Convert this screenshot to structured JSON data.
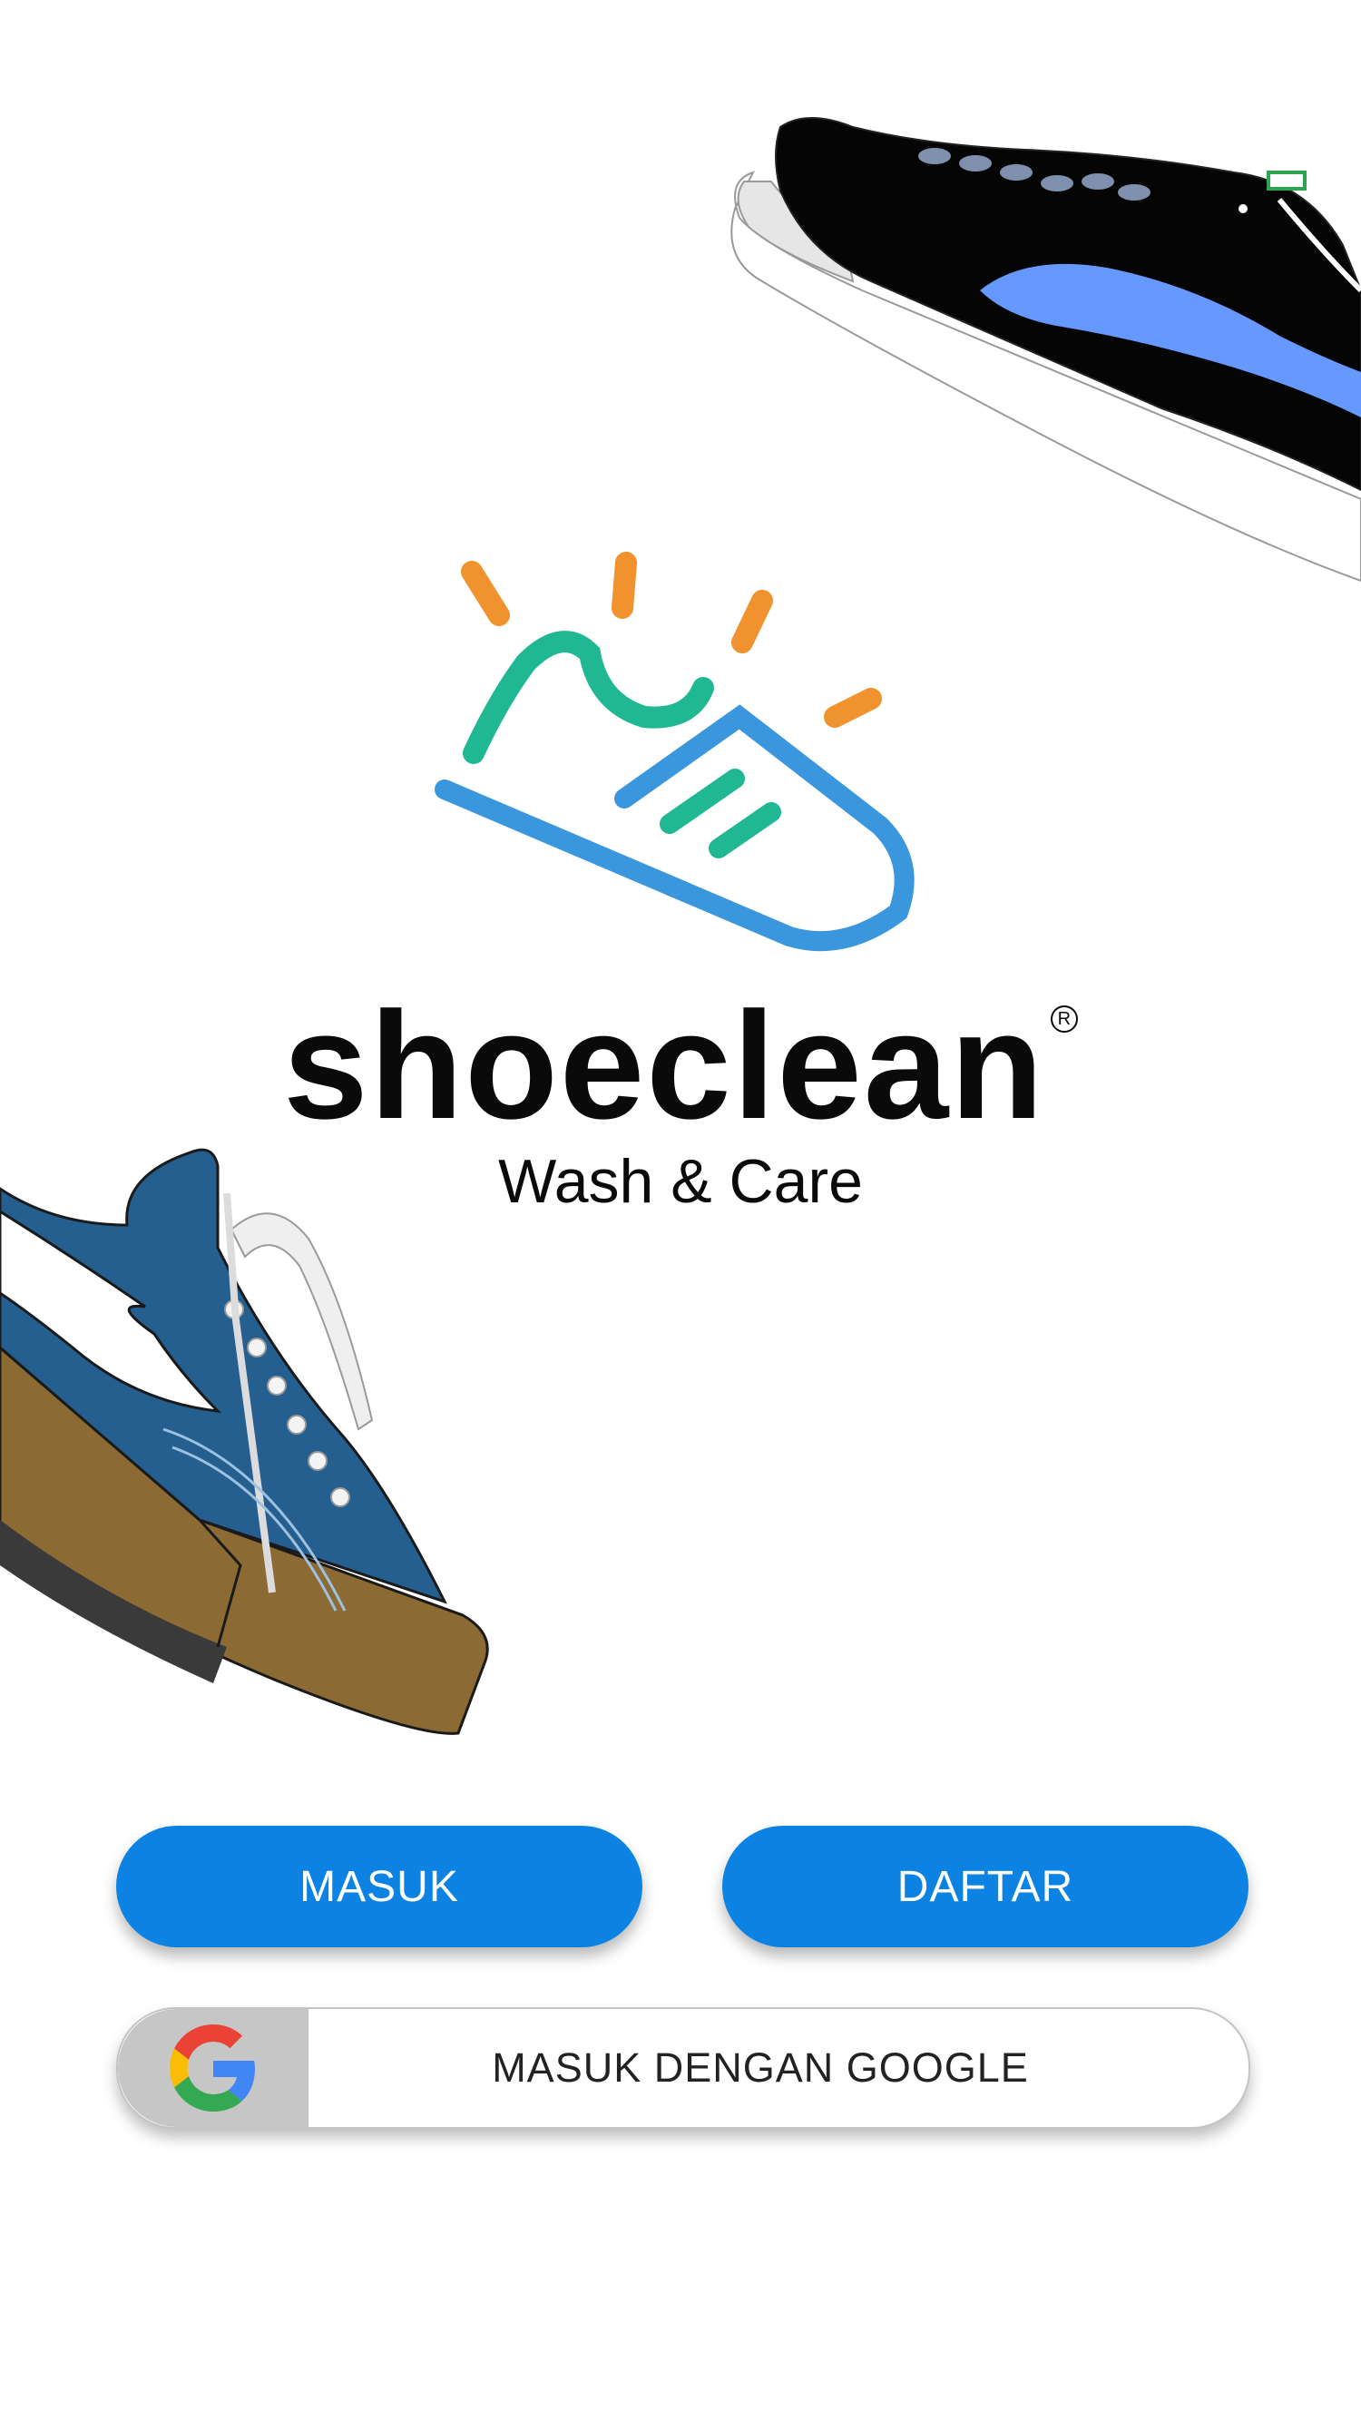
{
  "brand": {
    "name": "shoeclean",
    "registered_mark": "R",
    "tagline": "Wash & Care"
  },
  "actions": {
    "login_label": "MASUK",
    "register_label": "DAFTAR",
    "google_label": "MASUK DENGAN GOOGLE"
  },
  "icons": {
    "logo": "shoe-logo-icon",
    "google": "google-icon",
    "top_decoration": "black-sneaker-illustration",
    "bottom_decoration": "blue-sneaker-illustration"
  },
  "colors": {
    "primary_button": "#0c83e2",
    "logo_blue": "#3b97dd",
    "logo_green": "#20b893",
    "logo_orange": "#f0922d",
    "google_badge_bg": "#c6c6c6"
  }
}
